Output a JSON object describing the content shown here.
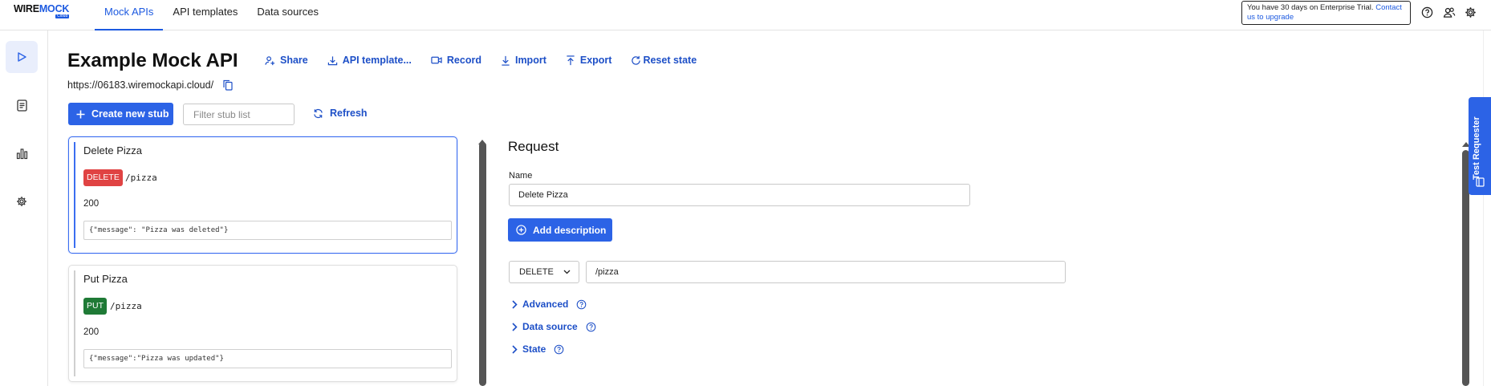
{
  "brand": {
    "logo_word1": "WIRE",
    "logo_word2": "MOCK",
    "logo_sub": "Cloud"
  },
  "nav": [
    {
      "label": "Mock APIs",
      "active": true
    },
    {
      "label": "API templates",
      "active": false
    },
    {
      "label": "Data sources",
      "active": false
    }
  ],
  "trial": {
    "text": "You have 30 days on Enterprise Trial.",
    "link": "Contact us to upgrade"
  },
  "header_icons": [
    "help-icon",
    "users-icon",
    "settings-icon"
  ],
  "rail": [
    "play-icon",
    "document-icon",
    "bar-chart-icon",
    "settings-icon"
  ],
  "api": {
    "title": "Example Mock API",
    "url": "https://06183.wiremockapi.cloud/",
    "actions": {
      "share": "Share",
      "api_template": "API template...",
      "record": "Record",
      "import": "Import",
      "export": "Export",
      "reset": "Reset state"
    }
  },
  "toolbar": {
    "create_label": "Create new stub",
    "filter_placeholder": "Filter stub list",
    "refresh_label": "Refresh"
  },
  "stubs": [
    {
      "name": "Delete Pizza",
      "method": "DELETE",
      "method_color": "#e04343",
      "path": "/pizza",
      "status": "200",
      "body": "{\"message\": \"Pizza was deleted\"}",
      "selected": true
    },
    {
      "name": "Put Pizza",
      "method": "PUT",
      "method_color": "#1f7a36",
      "path": "/pizza",
      "status": "200",
      "body": "{\"message\":\"Pizza was updated\"}",
      "selected": false
    }
  ],
  "request": {
    "title": "Request",
    "name_label": "Name",
    "name_value": "Delete Pizza",
    "add_description": "Add description",
    "method_value": "DELETE",
    "path_value": "/pizza",
    "sections": [
      "Advanced",
      "Data source",
      "State"
    ]
  },
  "side_panel": {
    "label": "Test Requester"
  },
  "colors": {
    "accent": "#2c63e6",
    "link": "#1d4fc7"
  }
}
